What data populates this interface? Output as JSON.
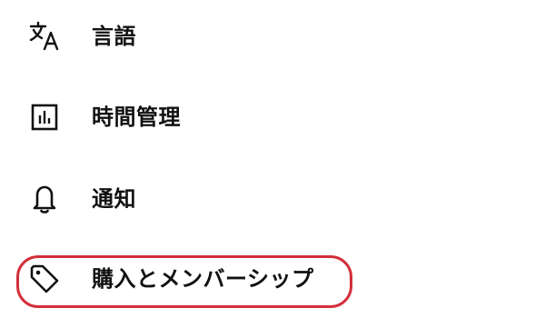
{
  "menu": {
    "items": [
      {
        "label": "言語",
        "icon": "translate-icon"
      },
      {
        "label": "時間管理",
        "icon": "bar-chart-icon"
      },
      {
        "label": "通知",
        "icon": "bell-icon"
      },
      {
        "label": "購入とメンバーシップ",
        "icon": "tag-icon"
      }
    ]
  },
  "colors": {
    "text": "#111111",
    "highlight": "#d32f3a",
    "background": "#ffffff"
  }
}
